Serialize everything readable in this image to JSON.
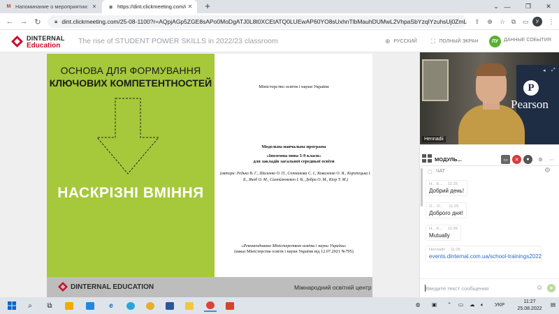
{
  "browser": {
    "tabs": [
      {
        "title": "Напоминание о мероприятии: «The...",
        "active": false
      },
      {
        "title": "https://dint.clickmeeting.com/rise...",
        "active": true
      }
    ],
    "new_tab": "+",
    "url": "dint.clickmeeting.com/25-08-1100?r=AQpjAGp5ZGE8sAPo0MoDgATJ0L8t0XCEtATQ0LUEwAP60YO8sUxhnTlbMauhDUMwL2VhpaSbYzqIYzuhsUj0ZmLSZGNm...",
    "profile_initial": "У"
  },
  "app": {
    "logo": {
      "line1": "DINTERNAL",
      "line2": "Education"
    },
    "event_title": "The rise of STUDENT POWER SKILLS in 2022/23 classroom",
    "language": "РУССКИЙ",
    "fullscreen": "ПОЛНЫЙ ЭКРАН",
    "user_initials": "ЛУ",
    "event_data": "ДАННЫЕ СОБЫТИЯ"
  },
  "slide": {
    "heading_line1": "ОСНОВА ДЛЯ ФОРМУВАННЯ",
    "heading_line2": "КЛЮЧОВИХ КОМПЕТЕНТНОСТЕЙ",
    "big_text": "НАСКРІЗНІ ВМІННЯ",
    "doc": {
      "ministry": "Міністерство освіти і науки України",
      "program": "Модельна навчальна програма",
      "subject": "«Іноземна мова 5-9 класи»",
      "institutions": "для закладів загальної середньої освіти",
      "authors": "(автори: Редько В. Г., Шаленко О. П., Сотникова С. І., Коваленко О. Я., Коропецька І. Б., Якоб О. М., Самойлюкевич І. В., Добра О. М., Кіор Т. М.)",
      "recommended": "«Рекомендовано Міністерством освіти і науки України»",
      "order": "(наказ Міністерства освіти і науки України від 12.07.2021 №795)"
    },
    "footer_brand": "DINTERNAL EDUCATION",
    "footer_center": "Міжнародний освітній центр"
  },
  "video": {
    "presenter_name": "Hennadii",
    "module_label": "МОДУЛЬ...",
    "brand_text": "Pearson"
  },
  "chat": {
    "title": "ЧАТ",
    "messages": [
      {
        "author": "Н... К...",
        "time": "11:25",
        "text": "Добрий день!"
      },
      {
        "author": "О... О...",
        "time": "11:25",
        "text": "Доброго дня!"
      },
      {
        "author": "Н... К...",
        "time": "11:26",
        "text": "Mutually"
      },
      {
        "author": "Hennadii",
        "time": "11:26",
        "text": "events.dinternal.com.ua/school-trainings2022"
      }
    ],
    "input_placeholder": "Введите текст сообщения"
  },
  "taskbar": {
    "language": "УКР",
    "time": "11:27",
    "date": "25.08.2022"
  }
}
